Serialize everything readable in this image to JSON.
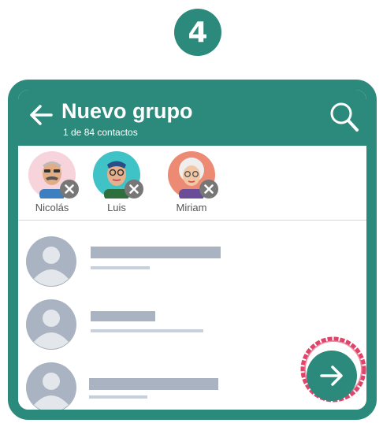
{
  "step_number": "4",
  "appbar": {
    "title": "Nuevo grupo",
    "subtitle": "1 de 84 contactos",
    "back_icon": "arrow-left-icon",
    "search_icon": "search-icon"
  },
  "selected_contacts": [
    {
      "name": "Nicolás",
      "avatar_bg": "#f7d3dc"
    },
    {
      "name": "Luis",
      "avatar_bg": "#3fc3c7"
    },
    {
      "name": "Miriam",
      "avatar_bg": "#ec8a74"
    }
  ],
  "contacts_placeholder_count": 3,
  "fab": {
    "icon": "arrow-right-icon",
    "highlight_color": "#e0446a"
  },
  "colors": {
    "primary": "#2c8a7d",
    "placeholder_avatar": "#a9b3c2"
  }
}
